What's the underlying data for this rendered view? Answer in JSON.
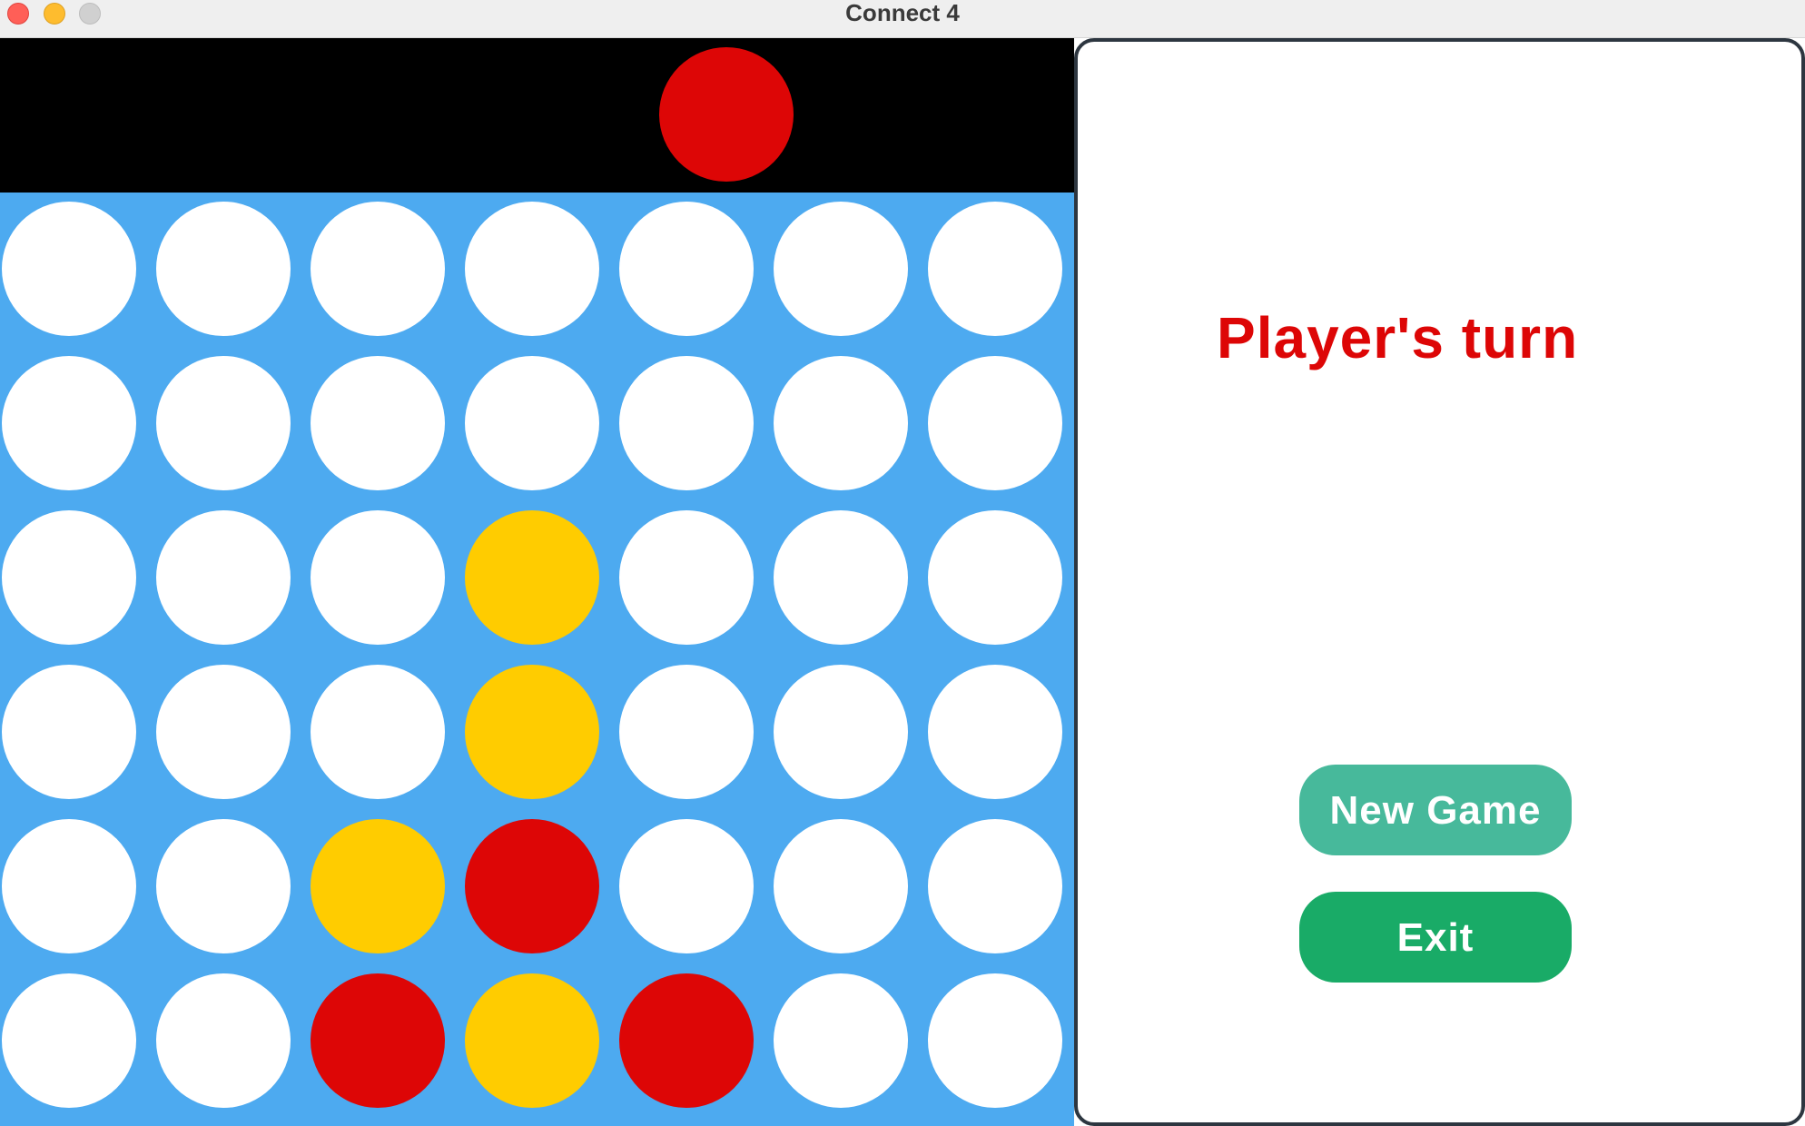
{
  "window": {
    "title": "Connect 4",
    "controls": [
      "close",
      "minimize",
      "maximize"
    ]
  },
  "colors": {
    "board": "#4daaf0",
    "empty": "#ffffff",
    "red": "#dd0606",
    "yellow": "#ffcc00",
    "drop_zone": "#000000",
    "turn_text": "#dd0606",
    "new_game_button": "#47b99b",
    "exit_button": "#19ab67"
  },
  "game": {
    "rows": 6,
    "columns": 7,
    "hover_column": 5,
    "hover_piece": "red",
    "board": [
      [
        "empty",
        "empty",
        "empty",
        "empty",
        "empty",
        "empty",
        "empty"
      ],
      [
        "empty",
        "empty",
        "empty",
        "empty",
        "empty",
        "empty",
        "empty"
      ],
      [
        "empty",
        "empty",
        "empty",
        "yellow",
        "empty",
        "empty",
        "empty"
      ],
      [
        "empty",
        "empty",
        "empty",
        "yellow",
        "empty",
        "empty",
        "empty"
      ],
      [
        "empty",
        "empty",
        "yellow",
        "red",
        "empty",
        "empty",
        "empty"
      ],
      [
        "empty",
        "empty",
        "red",
        "yellow",
        "red",
        "empty",
        "empty"
      ]
    ]
  },
  "panel": {
    "turn_text": "Player's turn",
    "new_game_label": "New Game",
    "exit_label": "Exit"
  }
}
